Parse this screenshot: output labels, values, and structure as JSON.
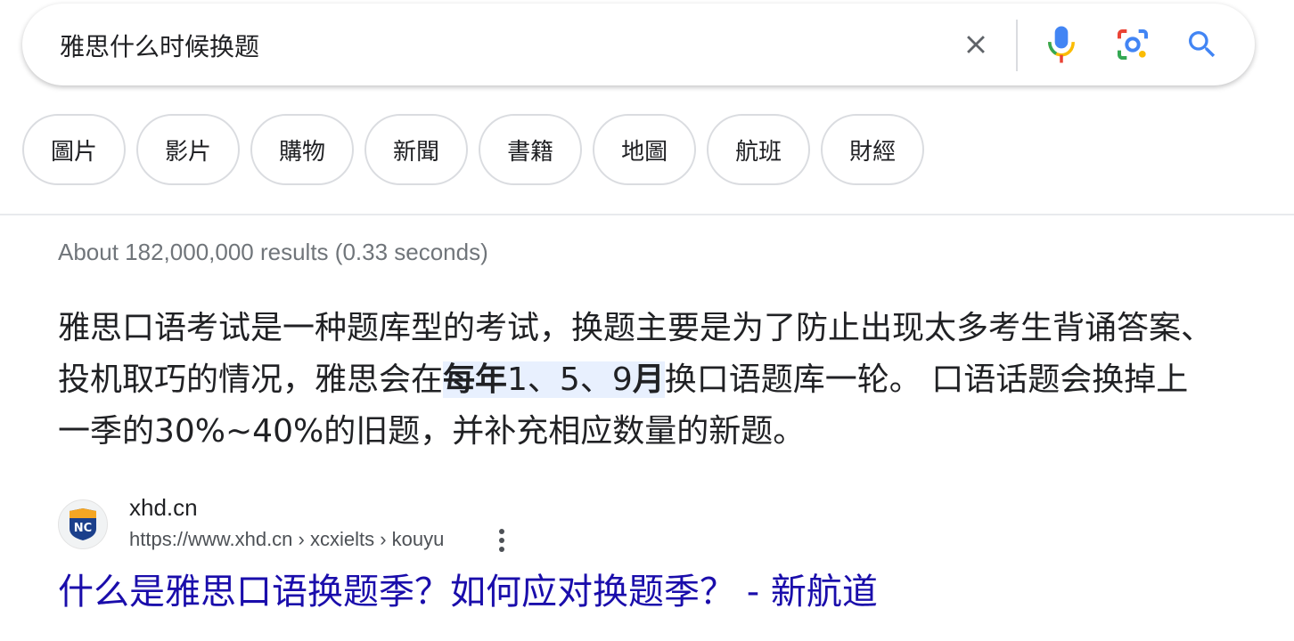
{
  "search": {
    "query": "雅思什么时候换题"
  },
  "colors": {
    "link": "#1a0dab",
    "result_stats": "#70757a",
    "highlight_bg": "#e8f0fe",
    "mic_blue": "#4285f4",
    "mic_red": "#ea4335",
    "search_blue": "#4285f4"
  },
  "icons": {
    "clear": "close-icon",
    "mic": "microphone-icon",
    "lens": "camera-lens-icon",
    "search": "search-icon",
    "more": "more-vert-icon"
  },
  "chips": [
    {
      "label": "圖片"
    },
    {
      "label": "影片"
    },
    {
      "label": "購物"
    },
    {
      "label": "新聞"
    },
    {
      "label": "書籍"
    },
    {
      "label": "地圖"
    },
    {
      "label": "航班"
    },
    {
      "label": "財經"
    }
  ],
  "result_stats": "About 182,000,000 results (0.33 seconds)",
  "featured_snippet": {
    "text_before": "雅思口语考试是一种题库型的考试，换题主要是为了防止出现太多考生背诵答案、投机取巧的情况，雅思会在",
    "highlight_bold_1": "每年",
    "highlight_normal_1": "1、5、9",
    "highlight_bold_2": "月",
    "text_after": "换口语题库一轮。 口语话题会换掉上一季的30%~40%的旧题，并补充相应数量的新题。"
  },
  "result": {
    "site_name": "xhd.cn",
    "url": "https://www.xhd.cn › xcxielts › kouyu",
    "favicon_text": "NC",
    "title": "什么是雅思口语换题季？如何应对换题季？ - 新航道"
  }
}
